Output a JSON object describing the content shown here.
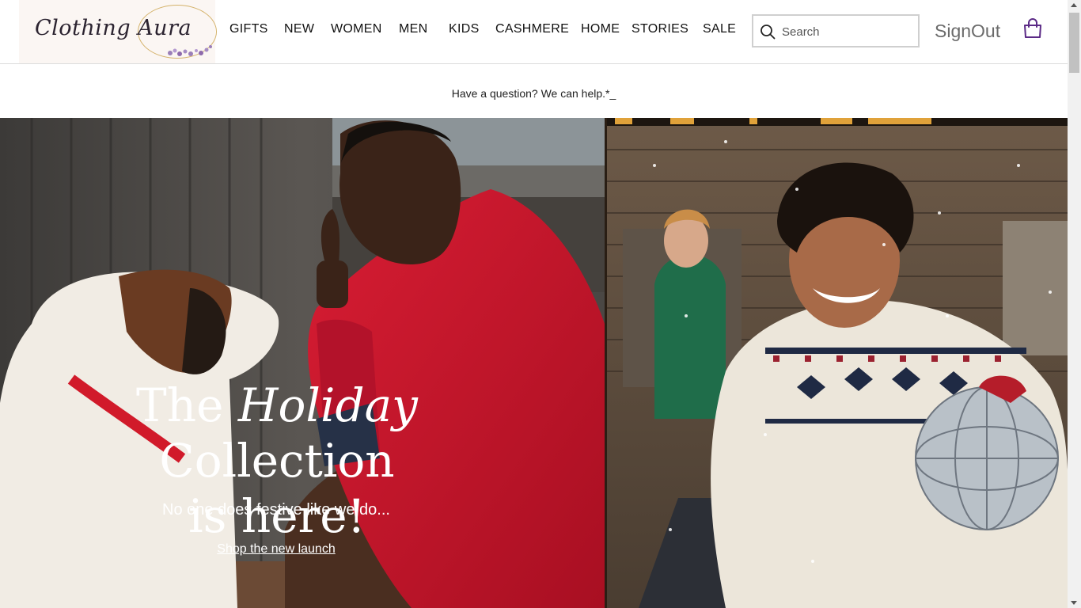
{
  "brand": {
    "logo_text": "Clothing Aura"
  },
  "nav": {
    "items": [
      {
        "label": "GIFTS"
      },
      {
        "label": "NEW"
      },
      {
        "label": "WOMEN"
      },
      {
        "label": "MEN"
      },
      {
        "label": "KIDS"
      },
      {
        "label": "CASHMERE"
      },
      {
        "label": "HOME"
      },
      {
        "label": "STORIES"
      },
      {
        "label": "SALE"
      }
    ]
  },
  "search": {
    "placeholder": "Search",
    "value": ""
  },
  "account": {
    "signout_label": "SignOut"
  },
  "help": {
    "text": "Have a question? We can help.*_"
  },
  "hero": {
    "title_part1": "The",
    "title_emphasis": "Holiday",
    "title_part2": "Collection",
    "title_line2": "is here!",
    "subtitle": "No one does festive like we do...",
    "link_label": "Shop the new launch"
  },
  "colors": {
    "accent_purple": "#5b2a86",
    "logo_gold": "#d4b26a",
    "jacket_red": "#c4142b"
  },
  "icons": {
    "search": "search-icon",
    "bag": "shopping-bag-icon"
  }
}
